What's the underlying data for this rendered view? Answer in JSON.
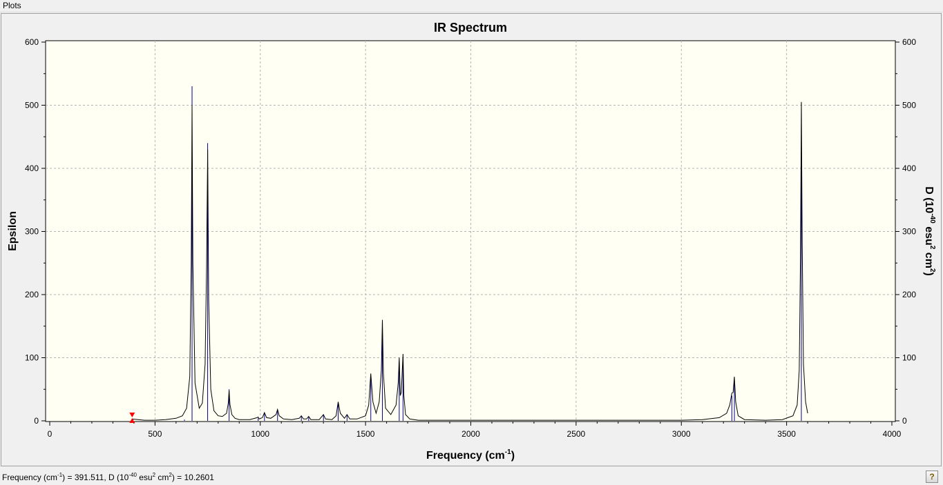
{
  "menu": {
    "plots_label": "Plots"
  },
  "status": {
    "freq_label": "Frequency (cm",
    "freq_exp": "-1",
    "freq_rest": ") = 391.511, D (10",
    "d_exp": "-40",
    "d_rest": " esu",
    "esu_exp": "2",
    "cm_part": " cm",
    "cm_exp": "2",
    "value_part": ") = 10.2601"
  },
  "help_icon": "question-icon",
  "colors": {
    "plot_bg": "#fffff4",
    "spectrum": "#000000",
    "sticks": "#00008b",
    "marker": "#ff0000"
  },
  "chart_data": {
    "type": "line",
    "title": "IR Spectrum",
    "xlabel": {
      "main": "Frequency (cm",
      "exp": "-1",
      "tail": ")"
    },
    "ylabel_left": "Epsilon",
    "ylabel_right": {
      "p1": "D (10",
      "e1": "-40",
      "p2": " esu",
      "e2": "2",
      "p3": " cm",
      "e3": "2",
      "p4": ")"
    },
    "xlim": [
      0,
      4000
    ],
    "ylim": [
      0,
      600
    ],
    "x_ticks": [
      "0",
      "500",
      "1000",
      "1500",
      "2000",
      "2500",
      "3000",
      "3500",
      "4000"
    ],
    "y_ticks": [
      "0",
      "100",
      "200",
      "300",
      "400",
      "500",
      "600"
    ],
    "grid": true,
    "marker": {
      "x": 391.511,
      "y": 0
    },
    "sticks": [
      {
        "x": 640,
        "y": 2
      },
      {
        "x": 676,
        "y": 530
      },
      {
        "x": 750,
        "y": 440
      },
      {
        "x": 852,
        "y": 50
      },
      {
        "x": 990,
        "y": 4
      },
      {
        "x": 1020,
        "y": 12
      },
      {
        "x": 1082,
        "y": 18
      },
      {
        "x": 1195,
        "y": 8
      },
      {
        "x": 1230,
        "y": 6
      },
      {
        "x": 1300,
        "y": 10
      },
      {
        "x": 1370,
        "y": 28
      },
      {
        "x": 1412,
        "y": 10
      },
      {
        "x": 1525,
        "y": 70
      },
      {
        "x": 1580,
        "y": 150
      },
      {
        "x": 1660,
        "y": 95
      },
      {
        "x": 1678,
        "y": 100
      },
      {
        "x": 3240,
        "y": 40
      },
      {
        "x": 3252,
        "y": 60
      },
      {
        "x": 3570,
        "y": 505
      }
    ],
    "series": [
      {
        "x": [
          390,
          420,
          450,
          500,
          550,
          600,
          630,
          650,
          665,
          672,
          676,
          680,
          690,
          710,
          725,
          738,
          745,
          750,
          755,
          765,
          780,
          800,
          820,
          840,
          848,
          852,
          856,
          865,
          880,
          900,
          950,
          985,
          990,
          995,
          1010,
          1020,
          1030,
          1050,
          1075,
          1082,
          1090,
          1110,
          1150,
          1185,
          1195,
          1205,
          1220,
          1230,
          1240,
          1280,
          1300,
          1310,
          1340,
          1360,
          1370,
          1380,
          1400,
          1412,
          1425,
          1460,
          1500,
          1515,
          1525,
          1535,
          1550,
          1565,
          1575,
          1580,
          1585,
          1595,
          1620,
          1645,
          1655,
          1660,
          1665,
          1670,
          1675,
          1678,
          1682,
          1690,
          1710,
          1750,
          1800,
          2000,
          2500,
          3000,
          3100,
          3180,
          3215,
          3230,
          3240,
          3246,
          3252,
          3258,
          3270,
          3300,
          3400,
          3480,
          3530,
          3550,
          3560,
          3566,
          3570,
          3574,
          3580,
          3590,
          3600
        ],
        "y": [
          3,
          2,
          1,
          1,
          2,
          4,
          8,
          20,
          70,
          250,
          500,
          250,
          60,
          20,
          28,
          90,
          245,
          430,
          190,
          50,
          16,
          8,
          7,
          12,
          28,
          48,
          26,
          10,
          4,
          2,
          2,
          5,
          6,
          3,
          5,
          13,
          5,
          4,
          10,
          18,
          8,
          3,
          2,
          4,
          8,
          3,
          3,
          7,
          2,
          2,
          10,
          3,
          2,
          8,
          30,
          12,
          4,
          10,
          3,
          3,
          8,
          25,
          75,
          30,
          12,
          30,
          80,
          160,
          75,
          20,
          10,
          25,
          60,
          100,
          40,
          45,
          85,
          106,
          40,
          10,
          3,
          1,
          1,
          1,
          1,
          1,
          2,
          5,
          12,
          25,
          44,
          45,
          70,
          30,
          8,
          2,
          1,
          2,
          8,
          25,
          80,
          260,
          505,
          280,
          90,
          30,
          12
        ]
      }
    ]
  }
}
